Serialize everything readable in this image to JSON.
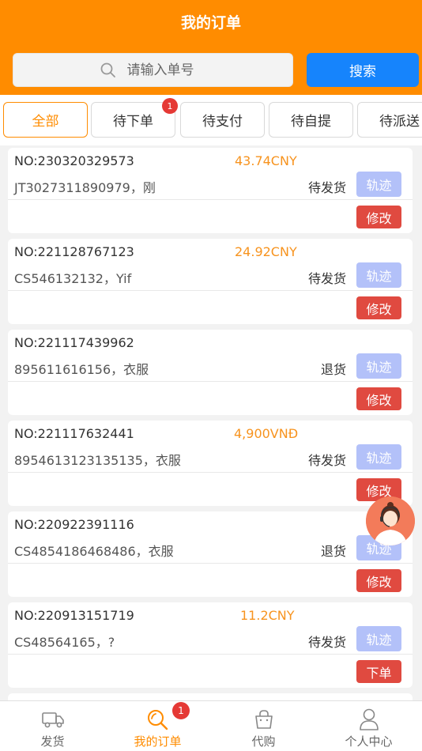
{
  "header": {
    "title": "我的订单"
  },
  "search": {
    "placeholder": "请输入单号",
    "button_label": "搜索"
  },
  "tabs": [
    {
      "label": "全部",
      "active": true
    },
    {
      "label": "待下单",
      "badge": "1"
    },
    {
      "label": "待支付"
    },
    {
      "label": "待自提"
    },
    {
      "label": "待派送"
    }
  ],
  "orders": [
    {
      "no": "NO:230320329573",
      "amount": "43.74CNY",
      "desc": "JT3027311890979，刚",
      "status": "待发货",
      "track_label": "轨迹",
      "action_label": "修改"
    },
    {
      "no": "NO:221128767123",
      "amount": "24.92CNY",
      "desc": "CS546132132，Yif",
      "status": "待发货",
      "track_label": "轨迹",
      "action_label": "修改"
    },
    {
      "no": "NO:221117439962",
      "amount": "",
      "desc": "895611616156，衣服",
      "status": "退货",
      "track_label": "轨迹",
      "action_label": "修改"
    },
    {
      "no": "NO:221117632441",
      "amount": "4,900VNĐ",
      "desc": "8954613123135135，衣服",
      "status": "待发货",
      "track_label": "轨迹",
      "action_label": "修改"
    },
    {
      "no": "NO:220922391116",
      "amount": "",
      "desc": "CS4854186468486，衣服",
      "status": "退货",
      "track_label": "轨迹",
      "action_label": "修改"
    },
    {
      "no": "NO:220913151719",
      "amount": "11.2CNY",
      "desc": "CS48564165，?",
      "status": "待发货",
      "track_label": "轨迹",
      "action_label": "下单"
    }
  ],
  "bottom_nav": [
    {
      "label": "发货",
      "icon": "truck-icon"
    },
    {
      "label": "我的订单",
      "icon": "search-orders-icon",
      "active": true,
      "badge": "1"
    },
    {
      "label": "代购",
      "icon": "shopping-bag-icon"
    },
    {
      "label": "个人中心",
      "icon": "person-icon"
    }
  ],
  "colors": {
    "primary": "#ff8c00",
    "search_button": "#1684fc",
    "track_button": "#b3c1f9",
    "edit_button": "#e04a40",
    "badge": "#e53935"
  }
}
